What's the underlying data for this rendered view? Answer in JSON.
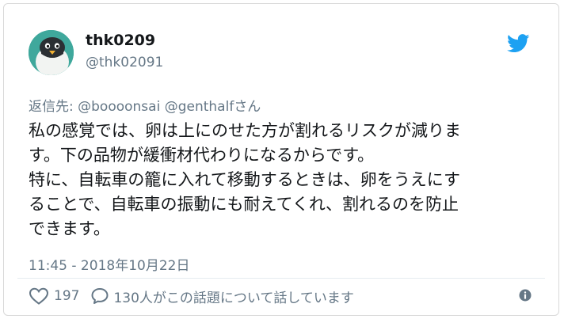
{
  "author": {
    "display_name": "thk0209",
    "screen_name": "@thk02091"
  },
  "reply": {
    "prefix": "返信先: ",
    "mention_1": "@boooonsai",
    "space": " ",
    "mention_2": "@genthalf",
    "suffix": "さん"
  },
  "tweet": {
    "lines": [
      "私の感覚では、卵は上にのせた方が割れるリスクが減りま",
      "す。下の品物が緩衝材代わりになるからです。",
      "特に、自転車の籠に入れて移動するときは、卵をうえにす",
      "ることで、自転車の振動にも耐えてくれ、割れるのを防止",
      "できます。"
    ]
  },
  "timestamp": "11:45 - 2018年10月22日",
  "actions": {
    "like_count": "197",
    "reply_text": "130人がこの話題について話しています"
  },
  "icons": {
    "brand": "twitter-bird-icon",
    "like": "heart-icon",
    "reply": "speech-bubble-icon",
    "info": "info-icon"
  },
  "colors": {
    "twitter_blue": "#1da1f2",
    "secondary_text": "#657786",
    "primary_text": "#14171a",
    "avatar_bg": "#3fa89c"
  }
}
